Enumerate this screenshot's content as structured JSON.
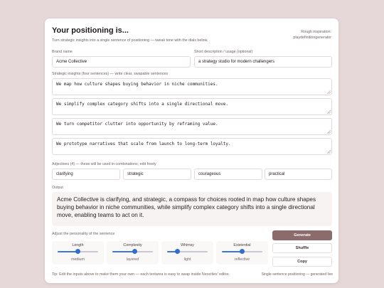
{
  "header": {
    "title": "Your positioning is...",
    "subtitle": "Turn strategic insights into a single sentence of positioning — tweak tone with the dials below.",
    "inspiration_line1": "Rough inspiration:",
    "inspiration_line2": "playdefinitiongenerator"
  },
  "fields": {
    "brand_label": "Brand name",
    "brand_value": "Acme Collective",
    "desc_label": "Short description / usage (optional)",
    "desc_value": "a strategy studio for modern challengers"
  },
  "insights": {
    "label": "Strategic insights (four sentences) — write clear, swapable sentences",
    "items": [
      "We map how culture shapes buying behavior in niche communities.",
      "We simplify complex category shifts into a single directional move.",
      "We turn competitor clutter into opportunity by reframing value.",
      "We prototype narratives that scale from launch to long-term loyalty."
    ]
  },
  "adjectives": {
    "label": "Adjectives (4) — these will be used in combinations; edit freely",
    "items": [
      "clarifying",
      "strategic",
      "courageous",
      "practical"
    ]
  },
  "output": {
    "label": "Output",
    "text": "Acme Collective is clarifying, and strategic, a compass for choices rooted in map how culture shapes buying behavior in niche communities, while simplify complex category shifts into a single directional move, enabling teams to act on it."
  },
  "dials": {
    "label": "Adjust the personality of the sentence",
    "items": [
      {
        "name": "Length",
        "value_label": "medium",
        "level": 0.5
      },
      {
        "name": "Complexity",
        "value_label": "layered",
        "level": 0.55
      },
      {
        "name": "Whimsy",
        "value_label": "light",
        "level": 0.25
      },
      {
        "name": "Existential",
        "value_label": "reflective",
        "level": 0.5
      }
    ]
  },
  "actions": {
    "generate": "Generate",
    "shuffle": "Shuffle",
    "copy": "Copy"
  },
  "footer": {
    "tip": "Tip: Edit the inputs above to make them your own — each textarea is easy to swap inside Neocities' editor.",
    "note": "Single-sentence positioning — generated live"
  },
  "colors": {
    "background": "#e6d8d8",
    "primary_button": "#8b6b6b",
    "slider_accent": "#2f6fd1"
  }
}
